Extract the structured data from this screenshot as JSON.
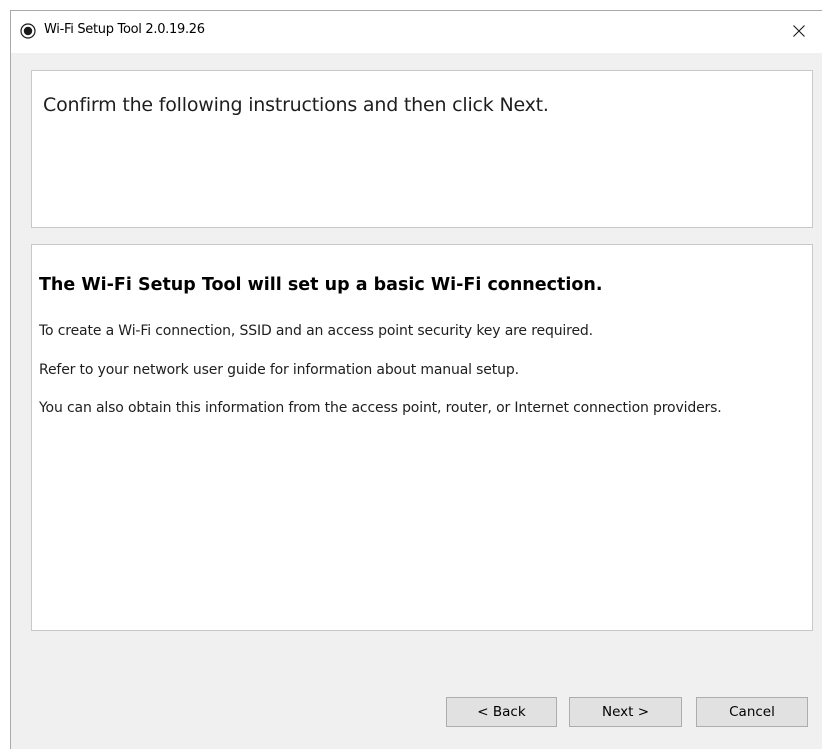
{
  "window": {
    "title": "Wi-Fi Setup Tool 2.0.19.26",
    "icon": "radio-target-icon",
    "close_glyph": "✕"
  },
  "instruction_panel": {
    "text": "Confirm the following instructions and then click Next."
  },
  "content_panel": {
    "heading": "The Wi-Fi Setup Tool will set up a basic Wi-Fi connection.",
    "paragraphs": [
      "To create a Wi-Fi connection, SSID and an access point security key are required.",
      "Refer to your network user guide for information about manual setup.",
      "You can also obtain this information from the access point, router, or Internet connection providers."
    ]
  },
  "buttons": {
    "back": "< Back",
    "next": "Next >",
    "cancel": "Cancel"
  },
  "colors": {
    "window_background": "#f0f0f0",
    "panel_background": "#ffffff",
    "button_background": "#e1e1e1"
  }
}
